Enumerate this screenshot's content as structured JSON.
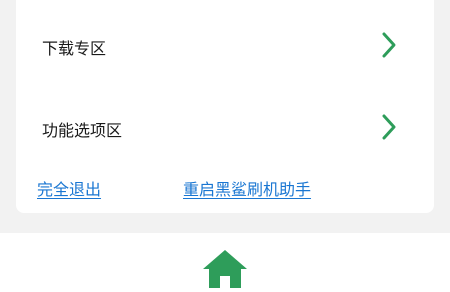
{
  "menu": {
    "items": [
      {
        "label": "下载专区",
        "icon": "chevron-right-icon"
      },
      {
        "label": "功能选项区",
        "icon": "chevron-right-icon"
      }
    ]
  },
  "links": {
    "exit_label": "完全退出",
    "restart_label": "重启黑鲨刷机助手"
  },
  "bottom_nav": {
    "home_icon": "home-icon"
  },
  "colors": {
    "accent_green": "#2e9d5a",
    "link_blue": "#1976d2",
    "background": "#f2f2f2",
    "card": "#ffffff",
    "text": "#1a1a1a"
  }
}
